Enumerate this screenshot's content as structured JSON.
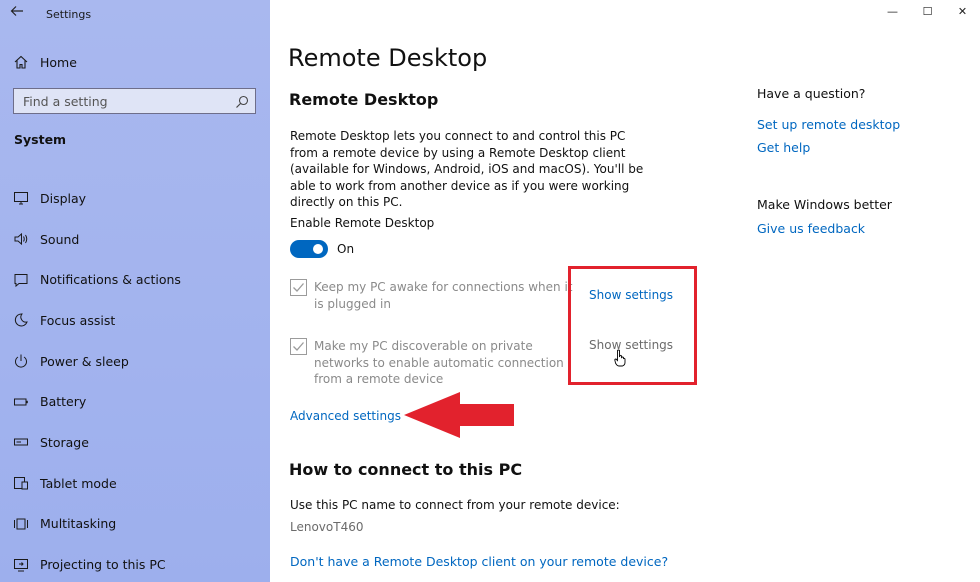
{
  "window": {
    "app_title": "Settings",
    "minimize": "—",
    "maximize": "☐",
    "close": "✕"
  },
  "sidebar": {
    "home_label": "Home",
    "search_placeholder": "Find a setting",
    "section_title": "System",
    "items": [
      {
        "label": "Display",
        "icon": "display-icon"
      },
      {
        "label": "Sound",
        "icon": "sound-icon"
      },
      {
        "label": "Notifications & actions",
        "icon": "notifications-icon"
      },
      {
        "label": "Focus assist",
        "icon": "focus-assist-icon"
      },
      {
        "label": "Power & sleep",
        "icon": "power-icon"
      },
      {
        "label": "Battery",
        "icon": "battery-icon"
      },
      {
        "label": "Storage",
        "icon": "storage-icon"
      },
      {
        "label": "Tablet mode",
        "icon": "tablet-mode-icon"
      },
      {
        "label": "Multitasking",
        "icon": "multitasking-icon"
      },
      {
        "label": "Projecting to this PC",
        "icon": "projecting-icon"
      }
    ]
  },
  "main": {
    "page_title": "Remote Desktop",
    "sub_title": "Remote Desktop",
    "description": "Remote Desktop lets you connect to and control this PC from a remote device by using a Remote Desktop client (available for Windows, Android, iOS and macOS). You'll be able to work from another device as if you were working directly on this PC.",
    "enable_label": "Enable Remote Desktop",
    "toggle_state": "On",
    "toggle_on": true,
    "options": [
      {
        "text": "Keep my PC awake for connections when it is plugged in",
        "checked": true,
        "link": "Show settings"
      },
      {
        "text": "Make my PC discoverable on private networks to enable automatic connection from a remote device",
        "checked": true,
        "link": "Show settings"
      }
    ],
    "advanced_link": "Advanced settings",
    "how_heading": "How to connect to this PC",
    "use_label": "Use this PC name to connect from your remote device:",
    "pc_name": "LenovoT460",
    "client_link": "Don't have a Remote Desktop client on your remote device?"
  },
  "help": {
    "question_heading": "Have a question?",
    "links": [
      "Set up remote desktop",
      "Get help"
    ],
    "better_heading": "Make Windows better",
    "feedback_link": "Give us feedback"
  },
  "colors": {
    "accent": "#0067c0",
    "annotation": "#e2222d",
    "sidebar_bg": "#a9b8ef"
  }
}
